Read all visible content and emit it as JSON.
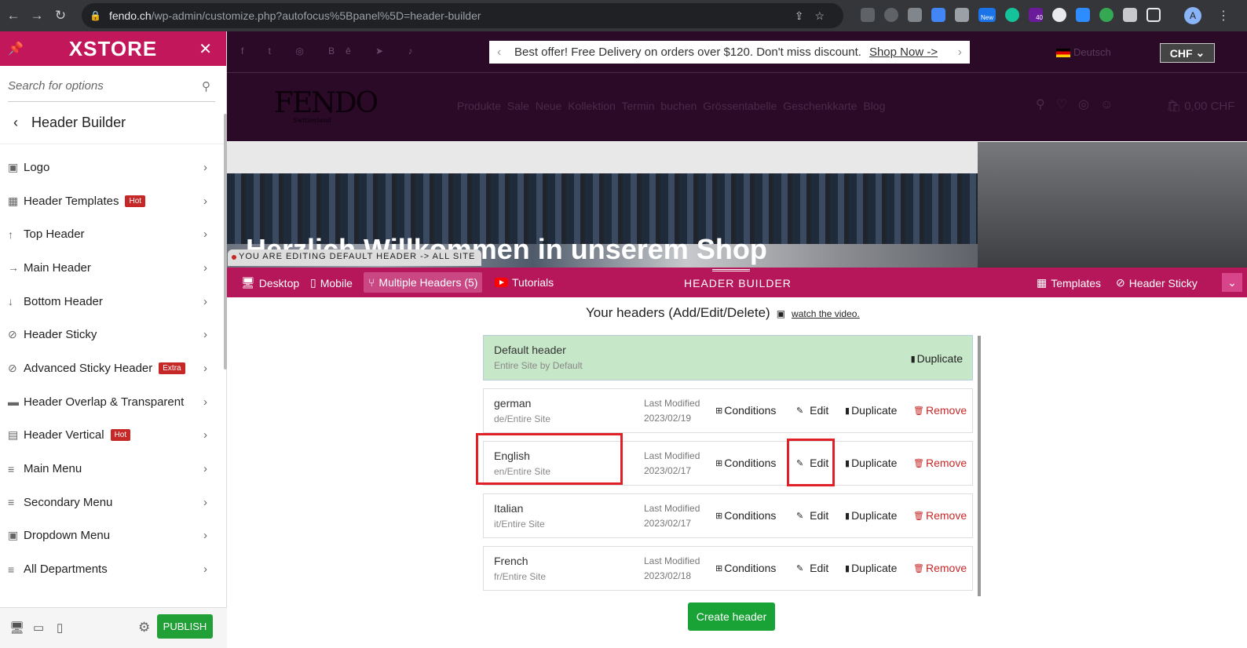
{
  "browser": {
    "url_host": "fendo.ch",
    "url_path": "/wp-admin/customize.php?autofocus%5Bpanel%5D=header-builder",
    "ext_new_label": "New",
    "ext_count": "40",
    "avatar_letter": "A"
  },
  "panel": {
    "brand": "XSTORE",
    "search_placeholder": "Search for options",
    "title": "Header Builder",
    "publish_label": "PUBLISH",
    "items": [
      {
        "label": "Logo",
        "icon": "image-icon",
        "glyph": "▣"
      },
      {
        "label": "Header Templates",
        "icon": "grid-icon",
        "glyph": "▦",
        "badge": "Hot"
      },
      {
        "label": "Top Header",
        "icon": "arrow-up-icon",
        "glyph": "↑"
      },
      {
        "label": "Main Header",
        "icon": "arrow-right-icon",
        "glyph": "→"
      },
      {
        "label": "Bottom Header",
        "icon": "arrow-down-icon",
        "glyph": "↓"
      },
      {
        "label": "Header Sticky",
        "icon": "pin-icon",
        "glyph": "⊘"
      },
      {
        "label": "Advanced Sticky Header",
        "icon": "pin-icon",
        "glyph": "⊘",
        "badge": "Extra"
      },
      {
        "label": "Header Overlap & Transparent",
        "icon": "layers-icon",
        "glyph": "▬"
      },
      {
        "label": "Header Vertical",
        "icon": "sidebar-icon",
        "glyph": "▤",
        "badge": "Hot"
      },
      {
        "label": "Main Menu",
        "icon": "menu-icon",
        "glyph": "≡"
      },
      {
        "label": "Secondary Menu",
        "icon": "menu-icon",
        "glyph": "≡"
      },
      {
        "label": "Dropdown Menu",
        "icon": "dropdown-icon",
        "glyph": "▣"
      },
      {
        "label": "All Departments",
        "icon": "menu-icon",
        "glyph": "≡"
      }
    ]
  },
  "site": {
    "promo_text": "Best offer! Free Delivery on orders over $120. Don't miss discount.",
    "promo_link": "Shop Now ->",
    "language": "Deutsch",
    "currency": "CHF",
    "logo_text": "FENDO",
    "logo_sub": "Switzerland",
    "menu": "Produkte  Sale  Neue Kollektion  Termin buchen  Grössentabelle  Geschenkkarte  Blog",
    "cart_total": "0,00 CHF",
    "hero_title": "Herzlich Willkommen in unserem Shop"
  },
  "builder": {
    "editing_notice": "YOU ARE EDITING DEFAULT HEADER -> ALL SITE",
    "tabs": {
      "desktop": "Desktop",
      "mobile": "Mobile",
      "multiple": "Multiple Headers (5)",
      "tutorials": "Tutorials"
    },
    "center_label": "HEADER BUILDER",
    "templates": "Templates",
    "header_sticky": "Header Sticky",
    "list_title": "Your headers (Add/Edit/Delete)",
    "video_link": "watch the video.",
    "default": {
      "name": "Default header",
      "sub": "Entire Site by Default",
      "duplicate": "Duplicate"
    },
    "lm_label": "Last Modified",
    "actions": {
      "conditions": "Conditions",
      "edit": "Edit",
      "duplicate": "Duplicate",
      "remove": "Remove"
    },
    "headers": [
      {
        "name": "german",
        "sub": "de/Entire Site",
        "date": "2023/02/19"
      },
      {
        "name": "English",
        "sub": "en/Entire Site",
        "date": "2023/02/17"
      },
      {
        "name": "Italian",
        "sub": "it/Entire Site",
        "date": "2023/02/17"
      },
      {
        "name": "French",
        "sub": "fr/Entire Site",
        "date": "2023/02/18"
      }
    ],
    "create_label": "Create header"
  }
}
